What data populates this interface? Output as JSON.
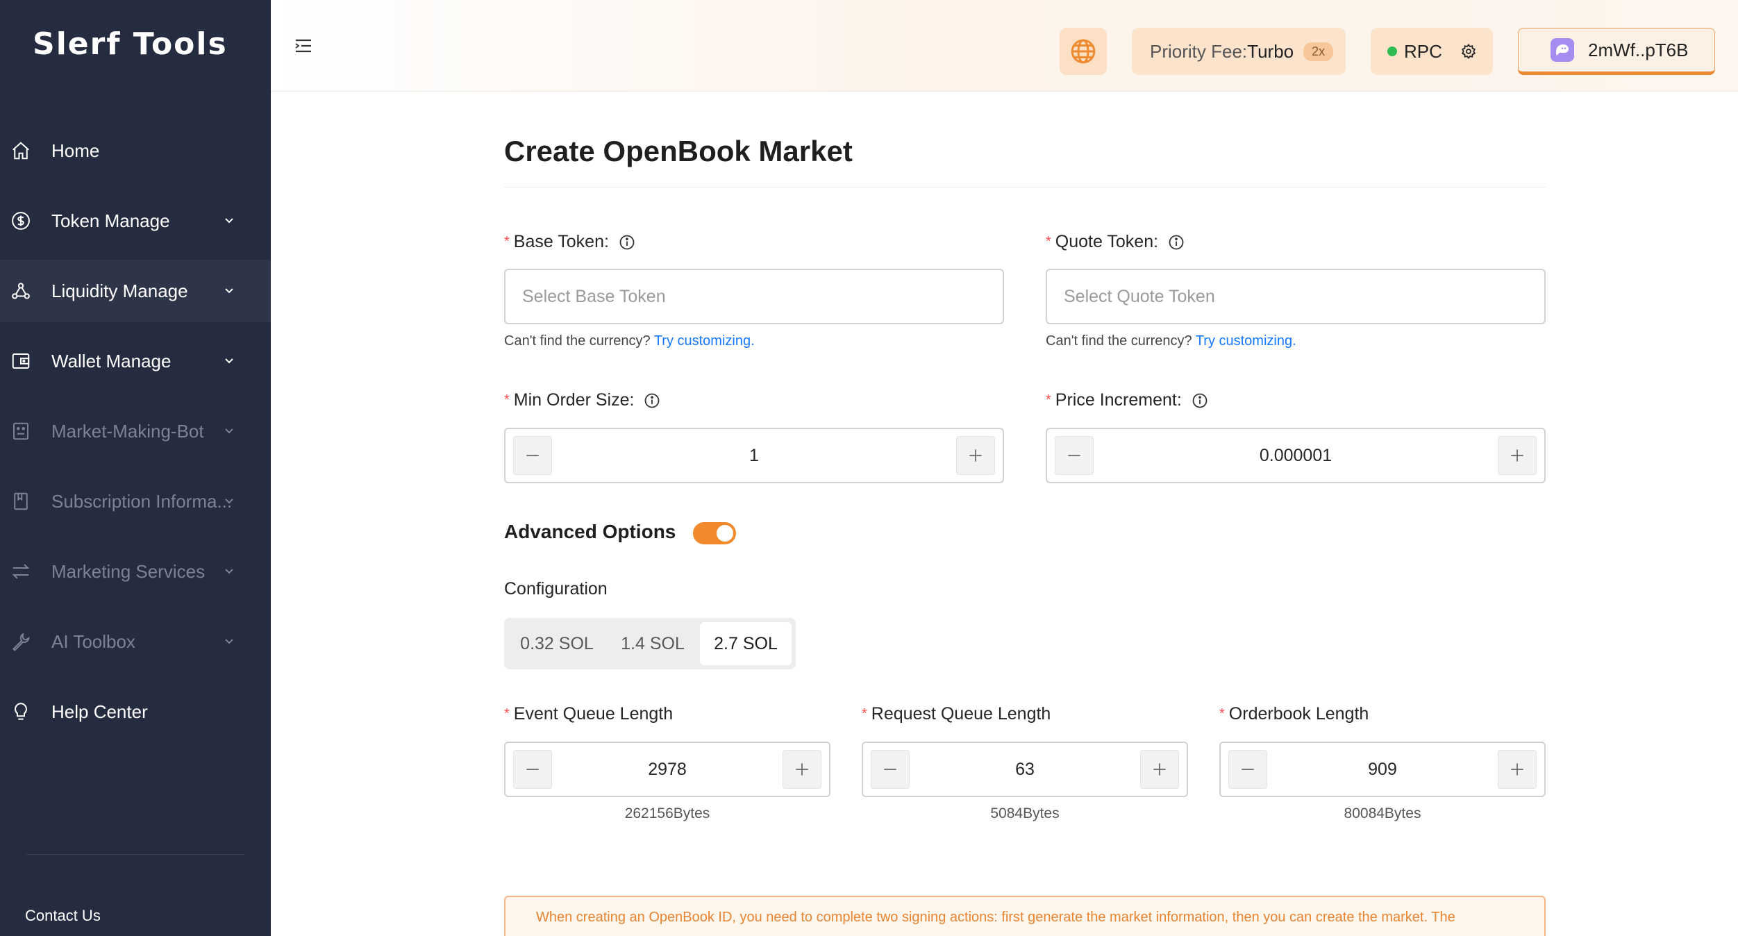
{
  "sidebar": {
    "logo": "Slerf Tools",
    "items": [
      {
        "label": "Home",
        "icon": "home-icon",
        "has_chevron": false
      },
      {
        "label": "Token Manage",
        "icon": "dollar-circle-icon",
        "has_chevron": true
      },
      {
        "label": "Liquidity Manage",
        "icon": "liquidity-nodes-icon",
        "has_chevron": true
      },
      {
        "label": "Wallet Manage",
        "icon": "wallet-icon",
        "has_chevron": true
      },
      {
        "label": "Market-Making-Bot",
        "icon": "robot-icon",
        "has_chevron": true
      },
      {
        "label": "Subscription Informa...",
        "icon": "bookmark-icon",
        "has_chevron": true
      },
      {
        "label": "Marketing Services",
        "icon": "swap-arrows-icon",
        "has_chevron": true
      },
      {
        "label": "AI Toolbox",
        "icon": "wrench-icon",
        "has_chevron": true
      },
      {
        "label": "Help Center",
        "icon": "lightbulb-icon",
        "has_chevron": false
      }
    ],
    "contact": "Contact Us"
  },
  "header": {
    "priority_fee_label": "Priority Fee:",
    "priority_fee_value": "Turbo",
    "priority_fee_multiplier": "2x",
    "rpc_label": "RPC",
    "wallet_address": "2mWf..pT6B",
    "accent_color": "#f08a2c"
  },
  "main": {
    "title": "Create OpenBook Market",
    "base_token": {
      "label": "Base Token:",
      "placeholder": "Select Base Token",
      "hint": "Can't find the currency?",
      "hint_link": "Try customizing."
    },
    "quote_token": {
      "label": "Quote Token:",
      "placeholder": "Select Quote Token",
      "hint": "Can't find the currency?",
      "hint_link": "Try customizing."
    },
    "min_order_size": {
      "label": "Min Order Size:",
      "value": "1"
    },
    "price_increment": {
      "label": "Price Increment:",
      "value": "0.000001"
    },
    "advanced_options": {
      "label": "Advanced Options",
      "enabled": true
    },
    "configuration": {
      "label": "Configuration",
      "options": [
        "0.32 SOL",
        "1.4 SOL",
        "2.7 SOL"
      ],
      "selected": "2.7 SOL"
    },
    "event_queue": {
      "label": "Event Queue Length",
      "value": "2978",
      "bytes": "262156Bytes"
    },
    "request_queue": {
      "label": "Request Queue Length",
      "value": "63",
      "bytes": "5084Bytes"
    },
    "orderbook": {
      "label": "Orderbook Length",
      "value": "909",
      "bytes": "80084Bytes"
    },
    "notice": "When creating an OpenBook ID, you need to complete two signing actions: first generate the market information, then you can create the market. The"
  }
}
